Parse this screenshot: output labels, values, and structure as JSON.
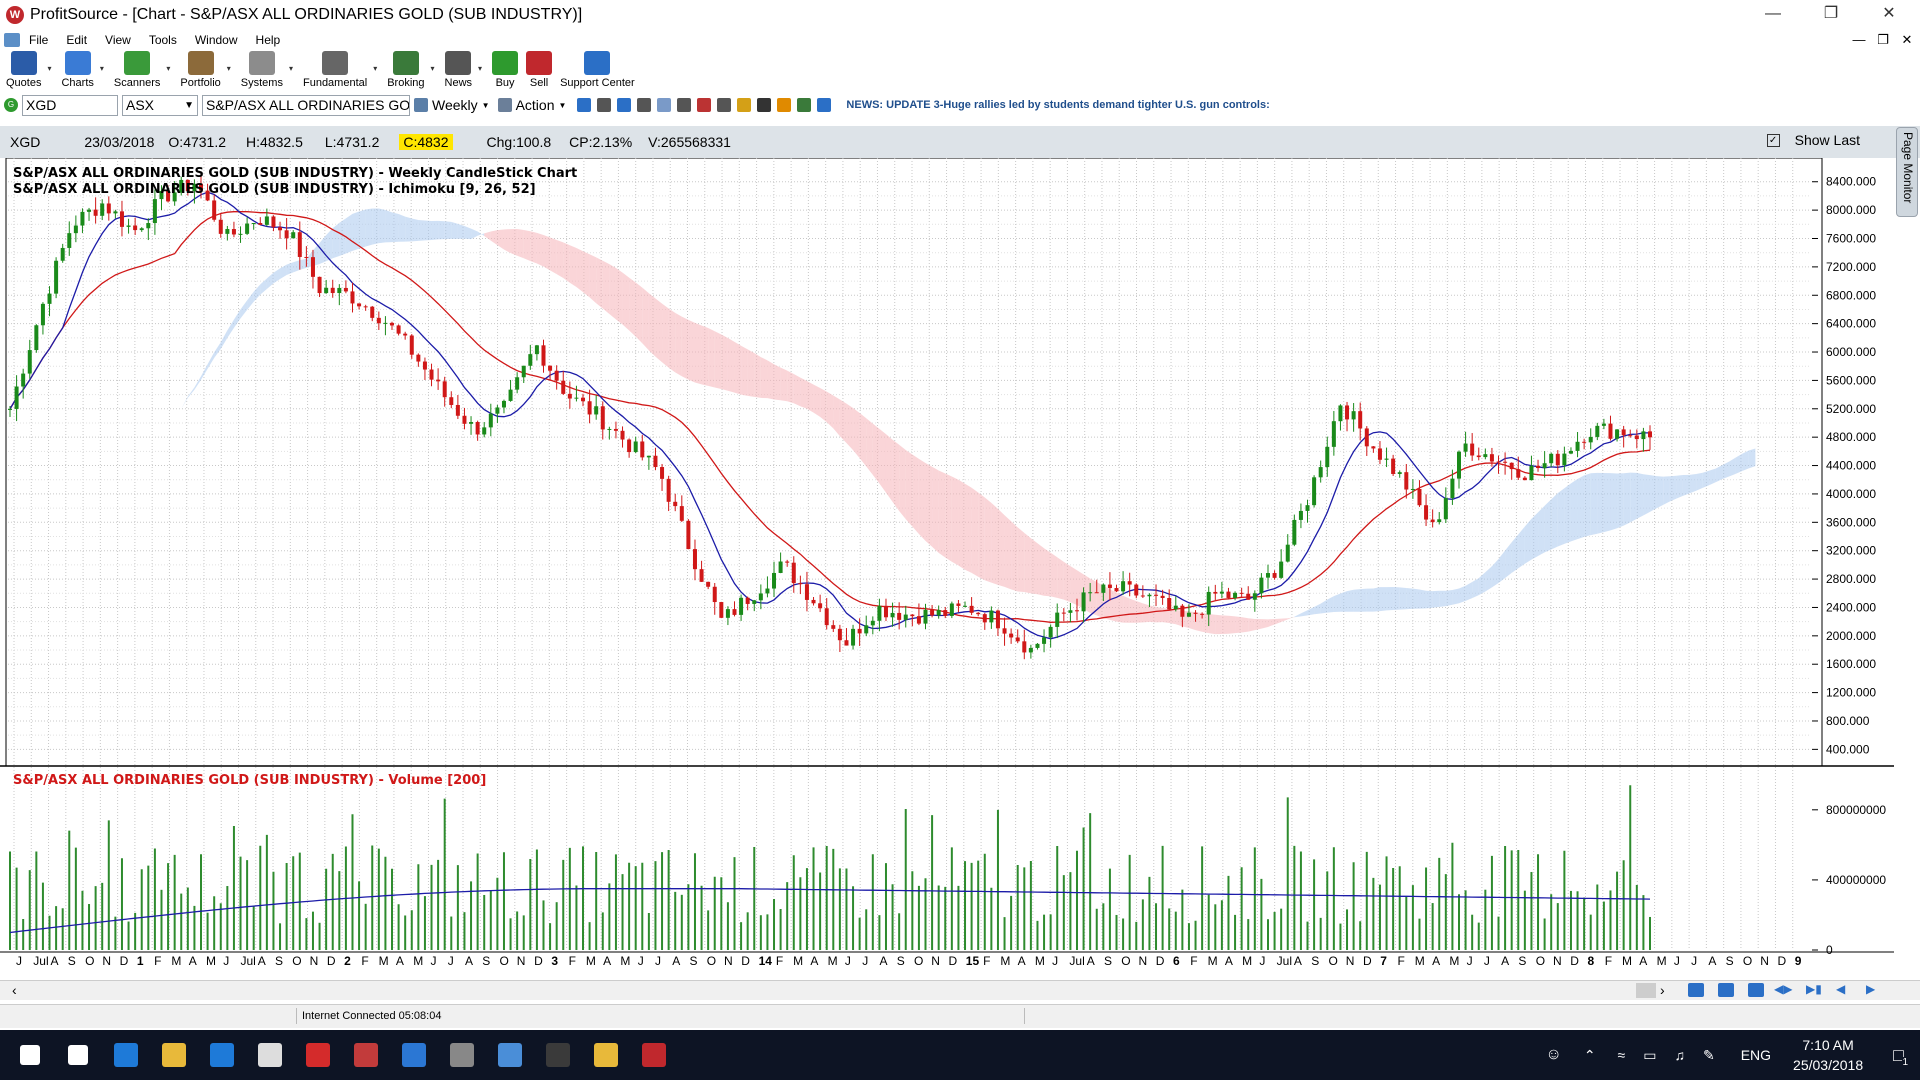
{
  "window": {
    "title": "ProfitSource - [Chart - S&P/ASX ALL ORDINARIES GOLD (SUB INDUSTRY)]",
    "logo_text": "W"
  },
  "menu": [
    "File",
    "Edit",
    "View",
    "Tools",
    "Window",
    "Help"
  ],
  "toolbar": [
    {
      "label": "Quotes",
      "icon": "quotes-icon",
      "color": "#2b5ca8",
      "dropdown": true
    },
    {
      "label": "Charts",
      "icon": "charts-icon",
      "color": "#3a7bd5",
      "dropdown": true
    },
    {
      "label": "Scanners",
      "icon": "scanners-icon",
      "color": "#3a9a3a",
      "dropdown": true
    },
    {
      "label": "Portfolio",
      "icon": "portfolio-icon",
      "color": "#8c6a3a",
      "dropdown": true
    },
    {
      "label": "Systems",
      "icon": "systems-icon",
      "color": "#8c8c8c",
      "dropdown": true
    },
    {
      "label": "Fundamental",
      "icon": "fundamental-icon",
      "color": "#666666",
      "dropdown": true
    },
    {
      "label": "Broking",
      "icon": "broking-icon",
      "color": "#3a7a3a",
      "dropdown": true
    },
    {
      "label": "News",
      "icon": "news-icon",
      "color": "#555555",
      "dropdown": true
    },
    {
      "label": "Buy",
      "icon": "buy-icon",
      "color": "#2e9a2e",
      "dropdown": false
    },
    {
      "label": "Sell",
      "icon": "sell-icon",
      "color": "#c0282d",
      "dropdown": false
    },
    {
      "label": "Support Center",
      "icon": "help-icon",
      "color": "#2b6fc6",
      "dropdown": false
    }
  ],
  "symbolbar": {
    "symbol": "XGD",
    "exchange": "ASX",
    "name": "S&P/ASX ALL ORDINARIES GOL",
    "period": "Weekly",
    "action": "Action",
    "news": "NEWS: UPDATE 3-Huge rallies led by students demand tighter U.S. gun controls:"
  },
  "quote": {
    "symbol": "XGD",
    "date": "23/03/2018",
    "open": "O:4731.2",
    "high": "H:4832.5",
    "low": "L:4731.2",
    "close": "C:4832",
    "change": "Chg:100.8",
    "change_pct": "CP:2.13%",
    "volume": "V:265568331",
    "show_last": "Show Last"
  },
  "side_tab": "Page Monitor",
  "chart_data": [
    {
      "type": "candlestick",
      "title": "S&P/ASX ALL ORDINARIES GOLD (SUB INDUSTRY) - Weekly CandleStick Chart",
      "subtitle": "S&P/ASX ALL ORDINARIES GOLD (SUB INDUSTRY) - Ichimoku [9, 26, 52]",
      "yticks": [
        "8400.000",
        "8000.000",
        "7600.000",
        "7200.000",
        "6800.000",
        "6400.000",
        "6000.000",
        "5600.000",
        "5200.000",
        "4800.000",
        "4400.000",
        "4000.000",
        "3600.000",
        "3200.000",
        "2800.000",
        "2400.000",
        "2000.000",
        "1600.000",
        "1200.000",
        "800.000",
        "400.000"
      ],
      "ylim": [
        250,
        8650
      ],
      "price_series": [
        5200,
        6600,
        7800,
        8100,
        7700,
        8200,
        8400,
        7600,
        7900,
        7700,
        6900,
        6800,
        6500,
        6000,
        5400,
        4900,
        5200,
        6100,
        5400,
        5100,
        4700,
        4300,
        3200,
        2200,
        2600,
        3000,
        2500,
        1900,
        2400,
        2300,
        2300,
        2400,
        2200,
        1800,
        2300,
        2600,
        2650,
        2500,
        2200,
        2600,
        2500,
        3000,
        4000,
        5300,
        4700,
        4200,
        3500,
        4700,
        4500,
        4300,
        4500,
        4900,
        4900,
        4800
      ]
    },
    {
      "type": "bar",
      "title": "S&P/ASX ALL ORDINARIES GOLD (SUB INDUSTRY) - Volume [200]",
      "yticks": [
        "800000000",
        "400000000",
        "0"
      ],
      "ylim": [
        0,
        1050000000
      ],
      "x_ticks": [
        "J",
        "Jul",
        "A",
        "S",
        "O",
        "N",
        "D",
        "1",
        "F",
        "M",
        "A",
        "M",
        "J",
        "Jul",
        "A",
        "S",
        "O",
        "N",
        "D",
        "2",
        "F",
        "M",
        "A",
        "M",
        "J",
        "J",
        "A",
        "S",
        "O",
        "N",
        "D",
        "3",
        "F",
        "M",
        "A",
        "M",
        "J",
        "J",
        "A",
        "S",
        "O",
        "N",
        "D",
        "14",
        "F",
        "M",
        "A",
        "M",
        "J",
        "J",
        "A",
        "S",
        "O",
        "N",
        "D",
        "15",
        "F",
        "M",
        "A",
        "M",
        "J",
        "Jul",
        "A",
        "S",
        "O",
        "N",
        "D",
        "6",
        "F",
        "M",
        "A",
        "M",
        "J",
        "Jul",
        "A",
        "S",
        "O",
        "N",
        "D",
        "7",
        "F",
        "M",
        "A",
        "M",
        "J",
        "J",
        "A",
        "S",
        "O",
        "N",
        "D",
        "8",
        "F",
        "M",
        "A",
        "M",
        "J",
        "J",
        "A",
        "S",
        "O",
        "N",
        "D",
        "9"
      ]
    }
  ],
  "status": {
    "connection": "Internet Connected 05:08:04"
  },
  "taskbar": {
    "language": "ENG",
    "time": "7:10 AM",
    "date": "25/03/2018",
    "notification_count": "1",
    "apps": [
      {
        "icon": "start-icon",
        "color": "#ffffff"
      },
      {
        "icon": "task-view-icon",
        "color": "#ffffff"
      },
      {
        "icon": "edge-icon",
        "color": "#1e7ad8"
      },
      {
        "icon": "file-explorer-icon",
        "color": "#e8b93a"
      },
      {
        "icon": "store-icon",
        "color": "#1e7ad8"
      },
      {
        "icon": "calculator-icon",
        "color": "#dddddd"
      },
      {
        "icon": "kaspersky-icon",
        "color": "#d42b2b"
      },
      {
        "icon": "paint-icon",
        "color": "#c23b3b"
      },
      {
        "icon": "defender-icon",
        "color": "#2b77d4"
      },
      {
        "icon": "camera-icon",
        "color": "#888888"
      },
      {
        "icon": "remote-desktop-icon",
        "color": "#4a8ed8"
      },
      {
        "icon": "gotrade-icon",
        "color": "#3a3a3a"
      },
      {
        "icon": "chrome-icon",
        "color": "#e8b93a"
      },
      {
        "icon": "profitsource-icon",
        "color": "#c0282d"
      }
    ]
  }
}
